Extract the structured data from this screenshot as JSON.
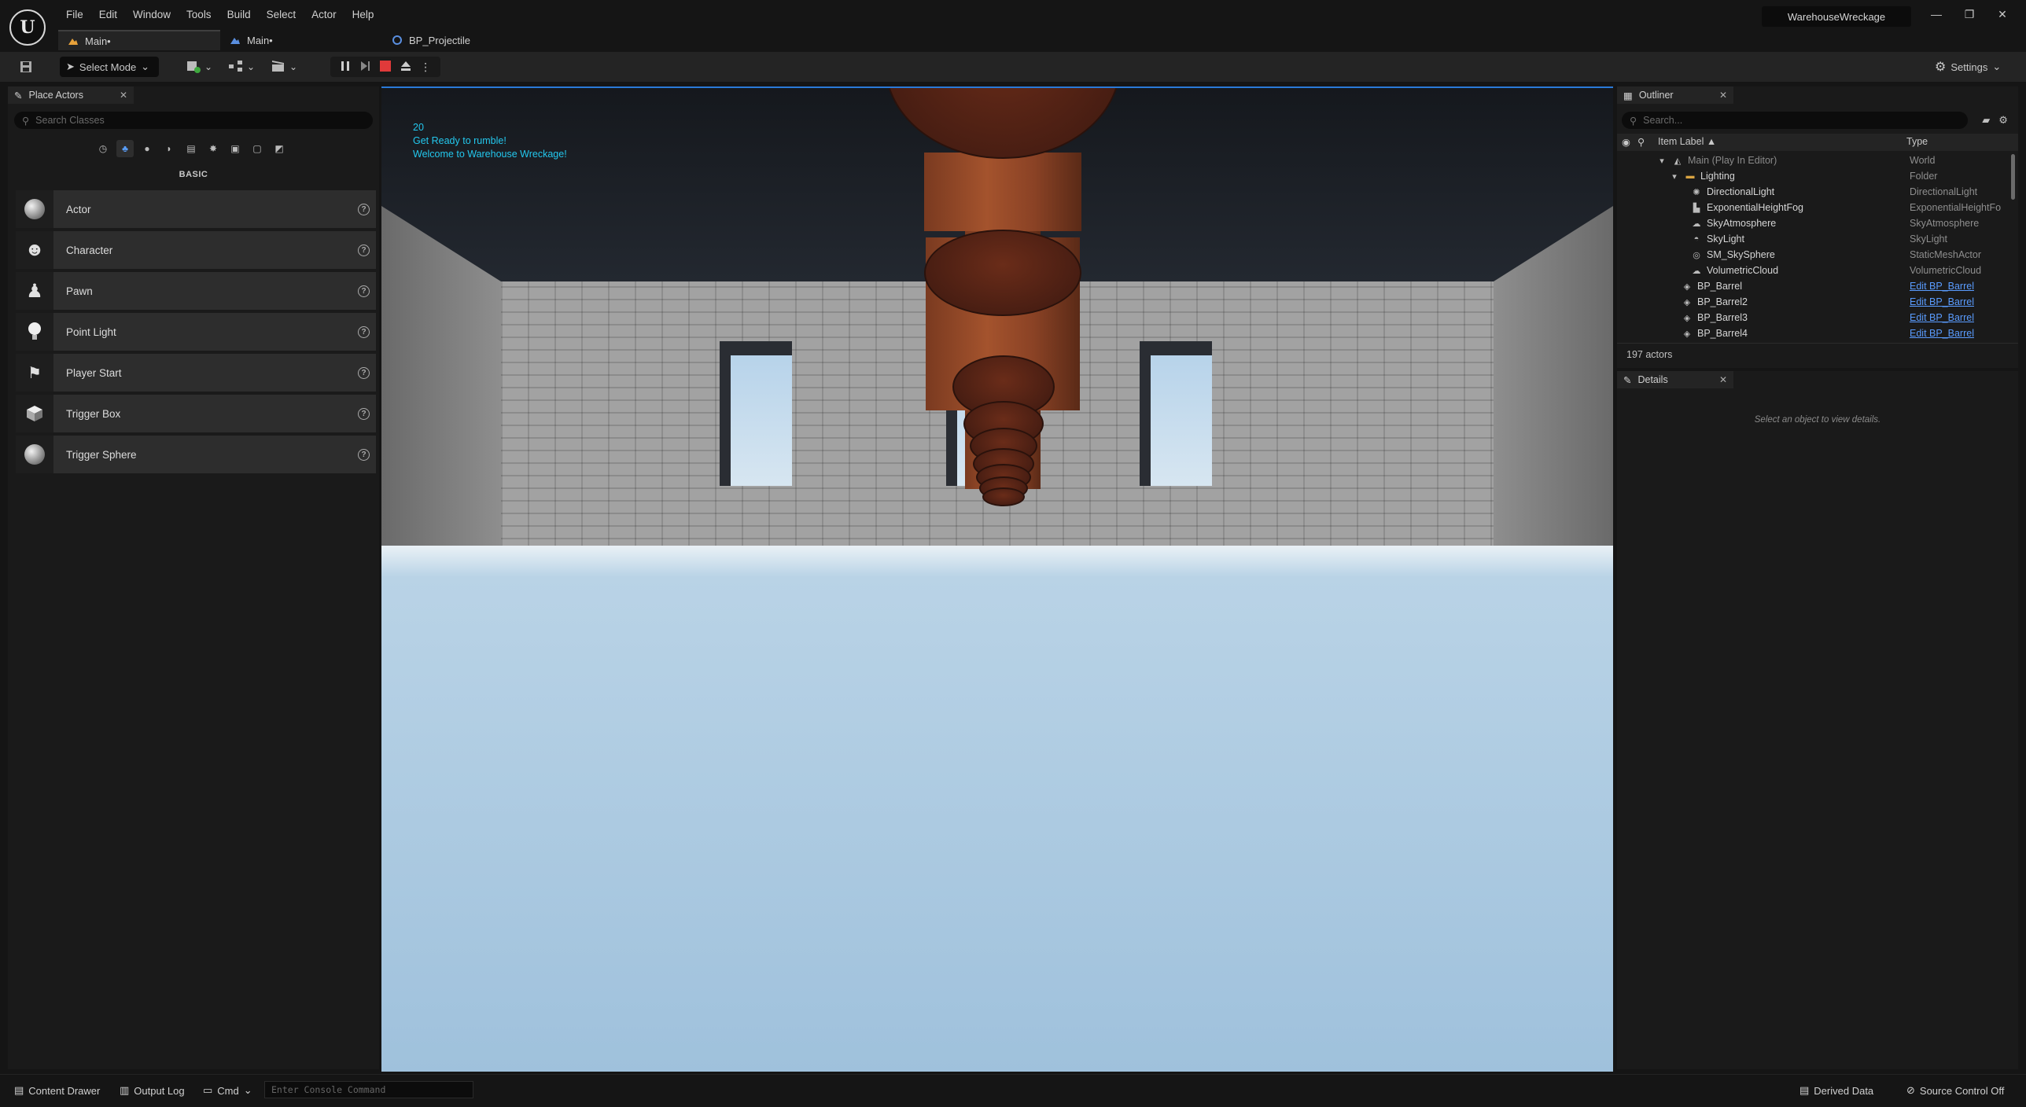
{
  "app": {
    "project_name": "WarehouseWreckage",
    "menu": [
      "File",
      "Edit",
      "Window",
      "Tools",
      "Build",
      "Select",
      "Actor",
      "Help"
    ],
    "tabs": [
      {
        "label": "Main•",
        "active": true
      },
      {
        "label": "Main•",
        "active": false
      },
      {
        "label": "BP_Projectile",
        "active": false
      }
    ]
  },
  "toolbar": {
    "select_mode": "Select Mode",
    "settings": "Settings"
  },
  "place_actors": {
    "title": "Place Actors",
    "search_placeholder": "Search Classes",
    "section": "BASIC",
    "items": [
      {
        "label": "Actor",
        "icon": "sphere-icon"
      },
      {
        "label": "Character",
        "icon": "character-icon"
      },
      {
        "label": "Pawn",
        "icon": "pawn-icon"
      },
      {
        "label": "Point Light",
        "icon": "light-bulb-icon"
      },
      {
        "label": "Player Start",
        "icon": "player-start-icon"
      },
      {
        "label": "Trigger Box",
        "icon": "cube-icon"
      },
      {
        "label": "Trigger Sphere",
        "icon": "sphere-icon"
      }
    ]
  },
  "viewport": {
    "hud_lines": [
      "20",
      "Get Ready to rumble!",
      "Welcome to Warehouse Wreckage!"
    ]
  },
  "outliner": {
    "title": "Outliner",
    "search_placeholder": "Search...",
    "col_label": "Item Label ▲",
    "col_type": "Type",
    "rows": [
      {
        "label": "Main (Play In Editor)",
        "type": "World",
        "indent": 0
      },
      {
        "label": "Lighting",
        "type": "Folder",
        "indent": 1
      },
      {
        "label": "DirectionalLight",
        "type": "DirectionalLight",
        "indent": 2
      },
      {
        "label": "ExponentialHeightFog",
        "type": "ExponentialHeightFo",
        "indent": 2
      },
      {
        "label": "SkyAtmosphere",
        "type": "SkyAtmosphere",
        "indent": 2
      },
      {
        "label": "SkyLight",
        "type": "SkyLight",
        "indent": 2
      },
      {
        "label": "SM_SkySphere",
        "type": "StaticMeshActor",
        "indent": 2
      },
      {
        "label": "VolumetricCloud",
        "type": "VolumetricCloud",
        "indent": 2
      },
      {
        "label": "BP_Barrel",
        "type": "Edit BP_Barrel",
        "indent": 1
      },
      {
        "label": "BP_Barrel2",
        "type": "Edit BP_Barrel",
        "indent": 1
      },
      {
        "label": "BP_Barrel3",
        "type": "Edit BP_Barrel",
        "indent": 1
      },
      {
        "label": "BP_Barrel4",
        "type": "Edit BP_Barrel",
        "indent": 1
      }
    ],
    "actor_count": "197 actors"
  },
  "details": {
    "title": "Details",
    "empty_message": "Select an object to view details."
  },
  "statusbar": {
    "content_drawer": "Content Drawer",
    "output_log": "Output Log",
    "cmd": "Cmd",
    "console_placeholder": "Enter Console Command",
    "derived_data": "Derived Data",
    "source_control": "Source Control Off"
  }
}
